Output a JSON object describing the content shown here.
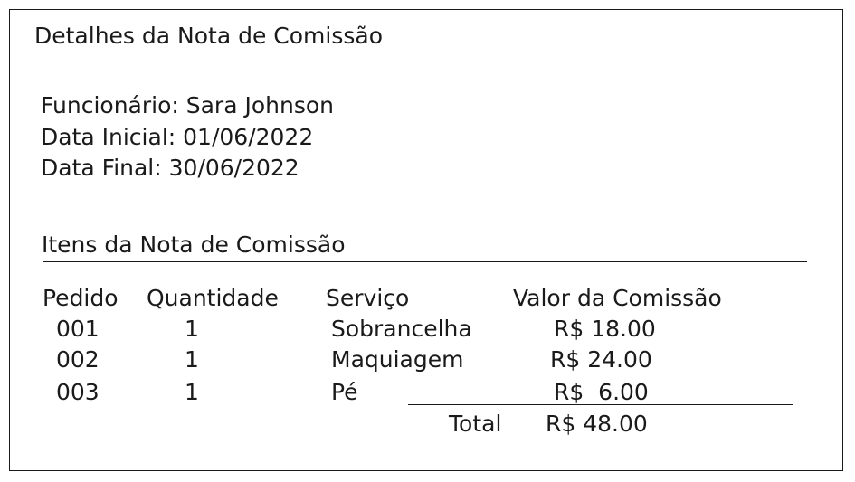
{
  "title": "Detalhes da Nota de Comissão",
  "info": {
    "employee": "Funcionário: Sara Johnson",
    "start_date": "Data Inicial: 01/06/2022",
    "end_date": "Data Final: 30/06/2022"
  },
  "section_title": "Itens da Nota de Comissão",
  "table": {
    "headers": [
      "Pedido",
      "Quantidade",
      "Serviço",
      "Valor da Comissão"
    ],
    "rows": [
      {
        "order": "001",
        "qty": "1",
        "service": "Sobrancelha",
        "value": "R$ 18.00"
      },
      {
        "order": "002",
        "qty": "1",
        "service": "Maquiagem",
        "value": "R$ 24.00"
      },
      {
        "order": "003",
        "qty": "1",
        "service": "Pé",
        "value": "R$  6.00"
      }
    ],
    "total_label": "Total",
    "total_value": "R$ 48.00"
  }
}
